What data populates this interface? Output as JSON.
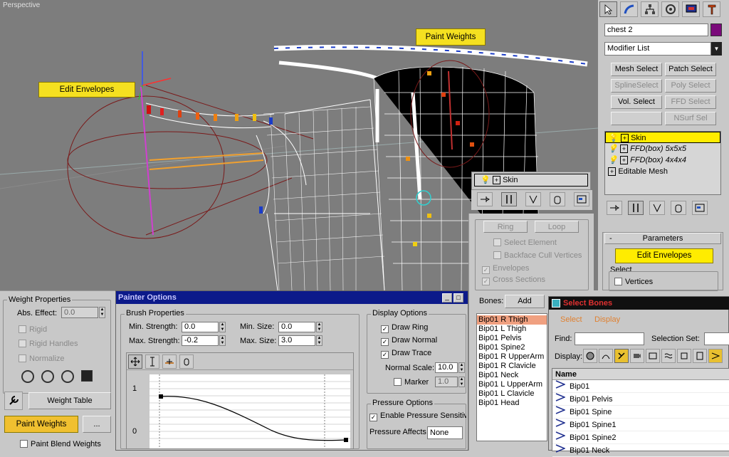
{
  "viewport": {
    "label": "Perspective",
    "edit_envelopes_label": "Edit Envelopes",
    "paint_weights_label": "Paint Weights"
  },
  "command_panel": {
    "object_name": "chest 2",
    "object_color": "#7a0a7a",
    "modifier_list_label": "Modifier List",
    "buttons": {
      "mesh_select": "Mesh Select",
      "patch_select": "Patch Select",
      "spline_select": "SplineSelect",
      "poly_select": "Poly Select",
      "vol_select": "Vol. Select",
      "ffd_select": "FFD Select",
      "nsurf_sel": "NSurf Sel"
    },
    "stack": [
      "Skin",
      "FFD(box) 5x5x5",
      "FFD(box) 4x4x4",
      "Editable Mesh"
    ],
    "parameters_label": "Parameters",
    "edit_envelopes_btn": "Edit Envelopes",
    "select_label": "Select",
    "vertices_label": "Vertices"
  },
  "skin_panel": {
    "title": "Skin",
    "ring": "Ring",
    "loop": "Loop",
    "select_element": "Select Element",
    "backface_cull": "Backface Cull Vertices",
    "envelopes": "Envelopes",
    "cross_sections": "Cross Sections",
    "bones_label": "Bones:",
    "add_btn": "Add",
    "bones": [
      "Bip01 R Thigh",
      "Bip01 L Thigh",
      "Bip01 Pelvis",
      "Bip01 Spine2",
      "Bip01 R UpperArm",
      "Bip01 R Clavicle",
      "Bip01 Neck",
      "Bip01 L UpperArm",
      "Bip01 L Clavicle",
      "Bip01 Head"
    ]
  },
  "weight_props": {
    "title": "Weight Properties",
    "abs_effect": "Abs. Effect:",
    "abs_value": "0.0",
    "rigid": "Rigid",
    "rigid_handles": "Rigid Handles",
    "normalize": "Normalize",
    "weight_table": "Weight Table",
    "paint_weights": "Paint Weights",
    "more": "...",
    "paint_blend": "Paint Blend Weights"
  },
  "painter": {
    "title": "Painter Options",
    "brush_props": "Brush Properties",
    "min_strength": "Min. Strength:",
    "min_strength_val": "0.0",
    "max_strength": "Max. Strength:",
    "max_strength_val": "-0.2",
    "min_size": "Min. Size:",
    "min_size_val": "0.0",
    "max_size": "Max. Size:",
    "max_size_val": "3.0",
    "curve_y_top": "1",
    "curve_y_bottom": "0",
    "display_options": "Display Options",
    "draw_ring": "Draw Ring",
    "draw_normal": "Draw Normal",
    "draw_trace": "Draw Trace",
    "normal_scale": "Normal Scale:",
    "normal_scale_val": "10.0",
    "marker": "Marker",
    "marker_val": "1.0",
    "pressure_options": "Pressure Options",
    "enable_pressure": "Enable Pressure Sensitiv",
    "pressure_affects": "Pressure Affects",
    "pressure_affects_val": "None"
  },
  "select_bones": {
    "title": "Select Bones",
    "menu": [
      "Select",
      "Display"
    ],
    "find": "Find:",
    "selection_set": "Selection Set:",
    "display": "Display:",
    "name_header": "Name",
    "items": [
      "Bip01",
      "Bip01 Pelvis",
      "Bip01 Spine",
      "Bip01 Spine1",
      "Bip01 Spine2",
      "Bip01 Neck"
    ]
  }
}
